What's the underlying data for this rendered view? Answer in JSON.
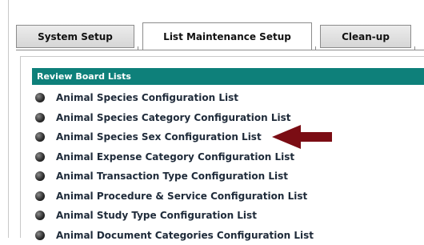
{
  "tabs": [
    {
      "label": "System Setup",
      "active": false
    },
    {
      "label": "List Maintenance Setup",
      "active": true
    },
    {
      "label": "Clean-up",
      "active": false
    }
  ],
  "panel": {
    "title": "Review Board Lists",
    "header_color": "#0e807a",
    "items": [
      {
        "label": "Animal Species Configuration List"
      },
      {
        "label": "Animal Species Category Configuration List"
      },
      {
        "label": "Animal Species Sex Configuration List"
      },
      {
        "label": "Animal Expense Category Configuration List"
      },
      {
        "label": "Animal Transaction Type Configuration List"
      },
      {
        "label": "Animal Procedure & Service Configuration List"
      },
      {
        "label": "Animal Study Type Configuration List"
      },
      {
        "label": "Animal Document Categories Configuration List"
      }
    ]
  },
  "annotation": {
    "arrow_color": "#7b0d14",
    "icon": "pointer-arrow-icon"
  }
}
